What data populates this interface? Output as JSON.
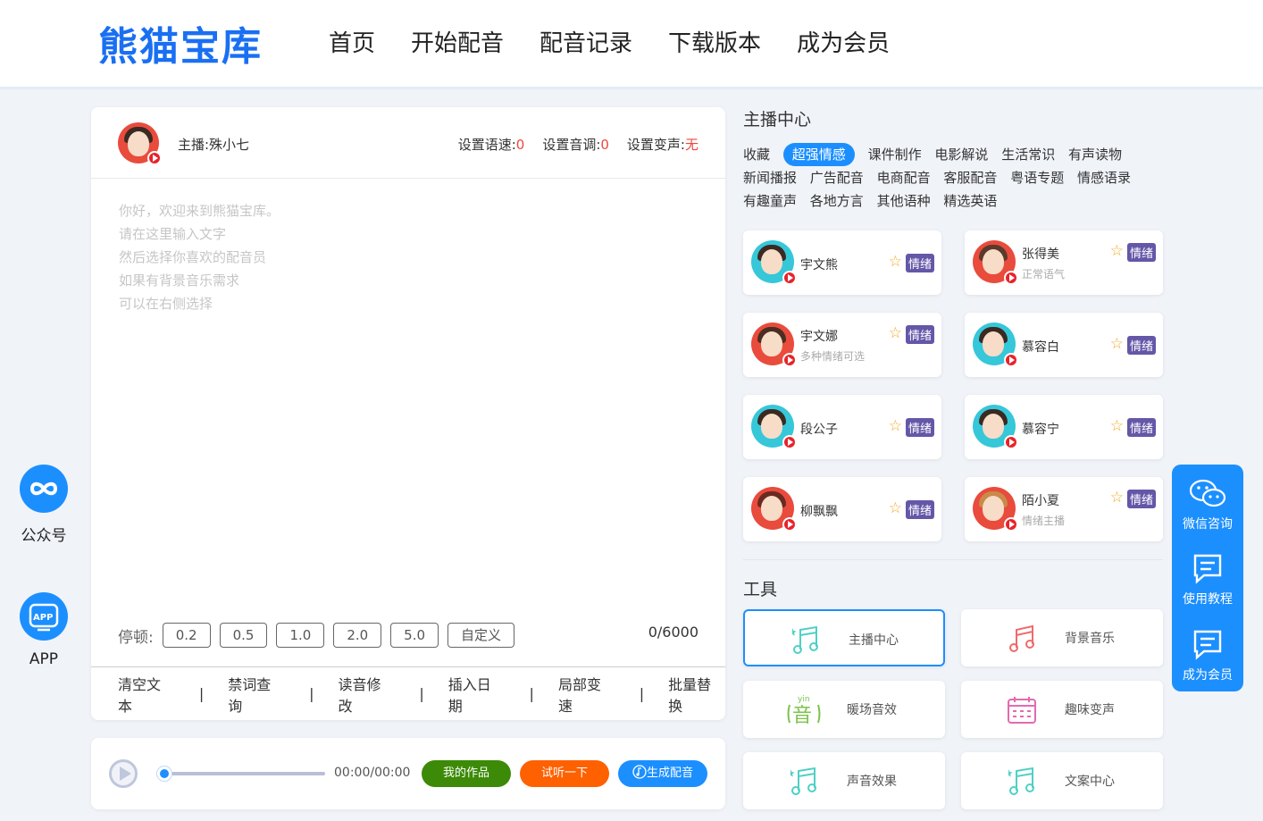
{
  "header": {
    "logo": "熊猫宝库",
    "nav": [
      "首页",
      "开始配音",
      "配音记录",
      "下载版本",
      "成为会员"
    ]
  },
  "editor": {
    "anchor_label": "主播:殊小七",
    "settings": {
      "speed_label": "设置语速:",
      "speed_value": "0",
      "pitch_label": "设置音调:",
      "pitch_value": "0",
      "voice_change_label": "设置变声:",
      "voice_change_value": "无"
    },
    "placeholder_lines": [
      "你好，欢迎来到熊猫宝库。",
      "请在这里输入文字",
      "然后选择你喜欢的配音员",
      "如果有背景音乐需求",
      "可以在右侧选择"
    ],
    "pause_label": "停顿:",
    "pause_options": [
      "0.2",
      "0.5",
      "1.0",
      "2.0",
      "5.0",
      "自定义"
    ],
    "char_count": "0/6000",
    "tools": [
      "清空文本",
      "禁词查询",
      "读音修改",
      "插入日期",
      "局部变速",
      "批量替换"
    ]
  },
  "player": {
    "progress": 0,
    "time": "00:00/00:00",
    "my_works": "我的作品",
    "try_listen": "试听一下",
    "generate": "生成配音"
  },
  "anchor_center": {
    "title": "主播中心",
    "categories": [
      [
        "收藏",
        "超强情感",
        "课件制作",
        "电影解说",
        "生活常识",
        "有声读物"
      ],
      [
        "新闻播报",
        "广告配音",
        "电商配音",
        "客服配音",
        "粤语专题",
        "情感语录"
      ],
      [
        "有趣童声",
        "各地方言",
        "其他语种",
        "精选英语"
      ]
    ],
    "active_category": "超强情感",
    "emotion_tag": "情绪",
    "anchors": [
      {
        "name": "宇文熊",
        "sub": ""
      },
      {
        "name": "张得美",
        "sub": "正常语气"
      },
      {
        "name": "宇文娜",
        "sub": "多种情绪可选"
      },
      {
        "name": "慕容白",
        "sub": ""
      },
      {
        "name": "段公子",
        "sub": ""
      },
      {
        "name": "慕容宁",
        "sub": ""
      },
      {
        "name": "柳飘飘",
        "sub": ""
      },
      {
        "name": "陌小夏",
        "sub": "情绪主播"
      }
    ]
  },
  "tools_section": {
    "title": "工具",
    "items": [
      "主播中心",
      "背景音乐",
      "暖场音效",
      "趣味变声",
      "声音效果",
      "文案中心"
    ],
    "yin_text": "yin",
    "yin_char": "音"
  },
  "left_float": {
    "wechat_label": "公众号",
    "app_label": "APP",
    "app_badge": "APP"
  },
  "right_float": {
    "items": [
      "微信咨询",
      "使用教程",
      "成为会员"
    ]
  },
  "colors": {
    "brand": "#1a6ff2",
    "accent": "#1c8fff",
    "green": "#3c8a07",
    "orange": "#ff6000",
    "red": "#f0463c",
    "emotion": "#6457a8"
  }
}
